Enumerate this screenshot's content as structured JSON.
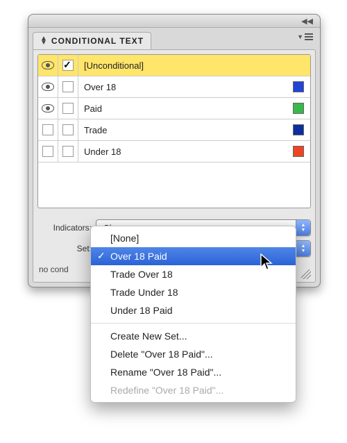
{
  "panel": {
    "title": "CONDITIONAL TEXT"
  },
  "conditions": [
    {
      "label": "[Unconditional]",
      "eye": true,
      "checked": true,
      "color": null,
      "selected": true
    },
    {
      "label": "Over 18",
      "eye": true,
      "checked": false,
      "color": "#2344d6",
      "selected": false
    },
    {
      "label": "Paid",
      "eye": true,
      "checked": false,
      "color": "#36b94a",
      "selected": false
    },
    {
      "label": "Trade",
      "eye": false,
      "checked": false,
      "color": "#0b2f9e",
      "selected": false
    },
    {
      "label": "Under 18",
      "eye": false,
      "checked": false,
      "color": "#ef4423",
      "selected": false
    }
  ],
  "indicators": {
    "label": "Indicators:",
    "value": "Show"
  },
  "set": {
    "label": "Set:",
    "value": "Over 18 Paid"
  },
  "status_text": "no conditions applied",
  "popup": {
    "items": [
      {
        "label": "[None]",
        "checked": false,
        "selected": false
      },
      {
        "label": "Over 18 Paid",
        "checked": true,
        "selected": true
      },
      {
        "label": "Trade Over 18",
        "checked": false,
        "selected": false
      },
      {
        "label": "Trade Under 18",
        "checked": false,
        "selected": false
      },
      {
        "label": "Under 18 Paid",
        "checked": false,
        "selected": false
      }
    ],
    "actions": [
      {
        "label": "Create New Set...",
        "disabled": false
      },
      {
        "label": "Delete \"Over 18 Paid\"...",
        "disabled": false
      },
      {
        "label": "Rename \"Over 18 Paid\"...",
        "disabled": false
      },
      {
        "label": "Redefine \"Over 18 Paid\"...",
        "disabled": true
      }
    ]
  }
}
